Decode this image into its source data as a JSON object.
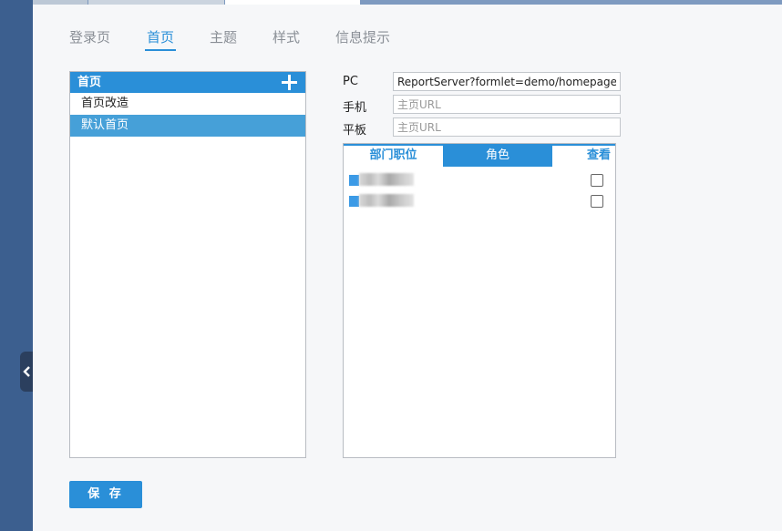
{
  "tabs": [
    {
      "label": "登录页",
      "active": false
    },
    {
      "label": "首页",
      "active": true
    },
    {
      "label": "主题",
      "active": false
    },
    {
      "label": "样式",
      "active": false
    },
    {
      "label": "信息提示",
      "active": false
    }
  ],
  "homepage_list": {
    "header": "首页",
    "add_icon": "plus-icon",
    "items": [
      {
        "label": "首页改造",
        "selected": false
      },
      {
        "label": "默认首页",
        "selected": true
      }
    ]
  },
  "fields": {
    "pc": {
      "label": "PC",
      "value": "ReportServer?formlet=demo/homepage/fi..."
    },
    "mobile": {
      "label": "手机",
      "placeholder": "主页URL"
    },
    "tablet": {
      "label": "平板",
      "placeholder": "主页URL"
    }
  },
  "permissions": {
    "tabs": [
      {
        "label": "部门职位",
        "active": false
      },
      {
        "label": "角色",
        "active": true
      }
    ],
    "view_column": "查看",
    "rows": [
      {
        "checked": false
      },
      {
        "checked": false
      }
    ]
  },
  "save_button": "保 存",
  "colors": {
    "accent": "#2a8fd8",
    "rail": "#3c5f8f",
    "selected_item": "#46a0d8"
  }
}
